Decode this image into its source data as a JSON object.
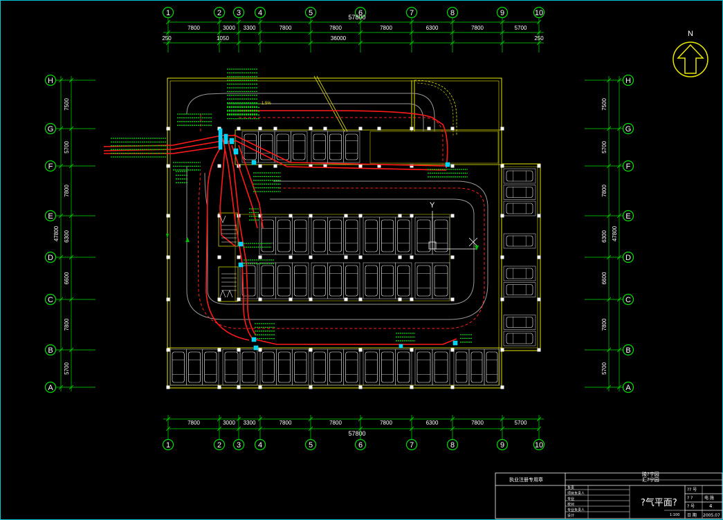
{
  "title_block": {
    "reg_stamp": "执业注册专用章",
    "sheet_title": "?气平面?",
    "project_line1": "陵?宁园",
    "project_line2": "汇?宁园",
    "drawing_no_label": "?? 号",
    "sheet_no_label1": "?  ?",
    "sheet_no_value1": "电  施",
    "sheet_no_label2": "?  号",
    "sheet_no_value2": "4",
    "date_label": "日  期",
    "date_value": "2005.07",
    "scale": "1:100",
    "roles": [
      "负责",
      "项目负责人",
      "专业",
      "校对",
      "专业负责人",
      "设计"
    ]
  },
  "north_label": "N",
  "grid": {
    "columns": [
      "1",
      "2",
      "3",
      "4",
      "5",
      "6",
      "7",
      "8",
      "9",
      "10"
    ],
    "rows": [
      "H",
      "G",
      "F",
      "E",
      "D",
      "C",
      "B",
      "A"
    ]
  },
  "dimensions": {
    "top_total": "57800",
    "top_spans": [
      "7800",
      "3000",
      "3300",
      "7800",
      "7800",
      "7800",
      "6300",
      "7800",
      "5700"
    ],
    "top_sub_left": "250",
    "top_sub_a": "1050",
    "top_sub_b": "36000",
    "top_sub_right": "250",
    "bottom_total": "57800",
    "bottom_spans": [
      "7800",
      "3000",
      "3300",
      "7800",
      "7800",
      "7800",
      "6300",
      "7800",
      "5700"
    ],
    "side_total": "47800",
    "side_spans": [
      "7500",
      "5700",
      "7800",
      "6300",
      "6600",
      "7800",
      "5700"
    ]
  },
  "annotations": {
    "axis_y": "Y",
    "slope_label": "1.5%"
  }
}
